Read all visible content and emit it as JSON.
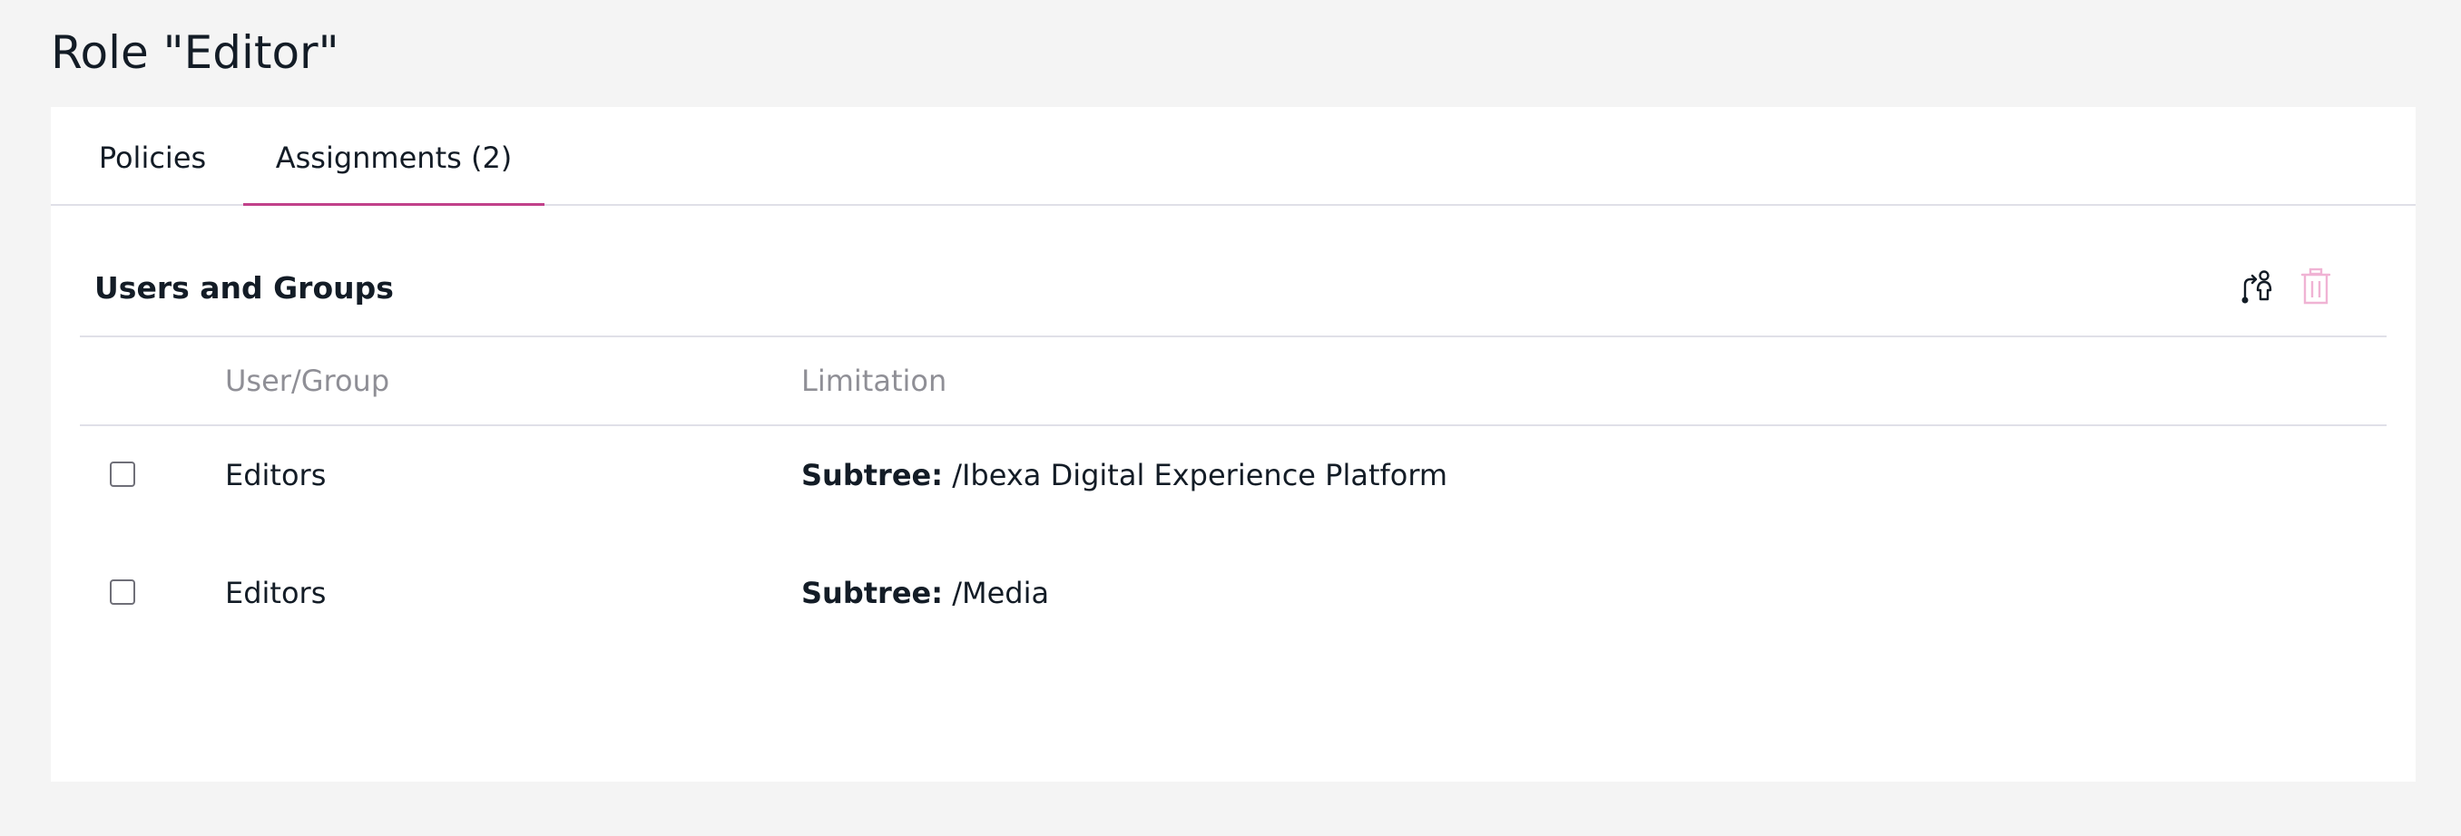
{
  "page": {
    "title": "Role \"Editor\""
  },
  "tabs": [
    {
      "label": "Policies",
      "active": false
    },
    {
      "label": "Assignments (2)",
      "active": true
    }
  ],
  "section": {
    "title": "Users and Groups",
    "actions": [
      {
        "icon": "assign-user-icon",
        "label": "Assign to Users/Groups"
      },
      {
        "icon": "trash-icon",
        "label": "Delete",
        "disabled": true
      }
    ]
  },
  "table": {
    "columns": [
      "User/Group",
      "Limitation"
    ],
    "rows": [
      {
        "checked": false,
        "user": "Editors",
        "limitation_key": "Subtree:",
        "limitation_value": " /Ibexa Digital Experience Platform"
      },
      {
        "checked": false,
        "user": "Editors",
        "limitation_key": "Subtree:",
        "limitation_value": " /Media"
      }
    ]
  },
  "colors": {
    "accent": "#c1418a",
    "disabled_icon": "#f0b3d4",
    "background": "#f4f4f4",
    "card": "#ffffff",
    "muted_text": "#8f8f96"
  }
}
